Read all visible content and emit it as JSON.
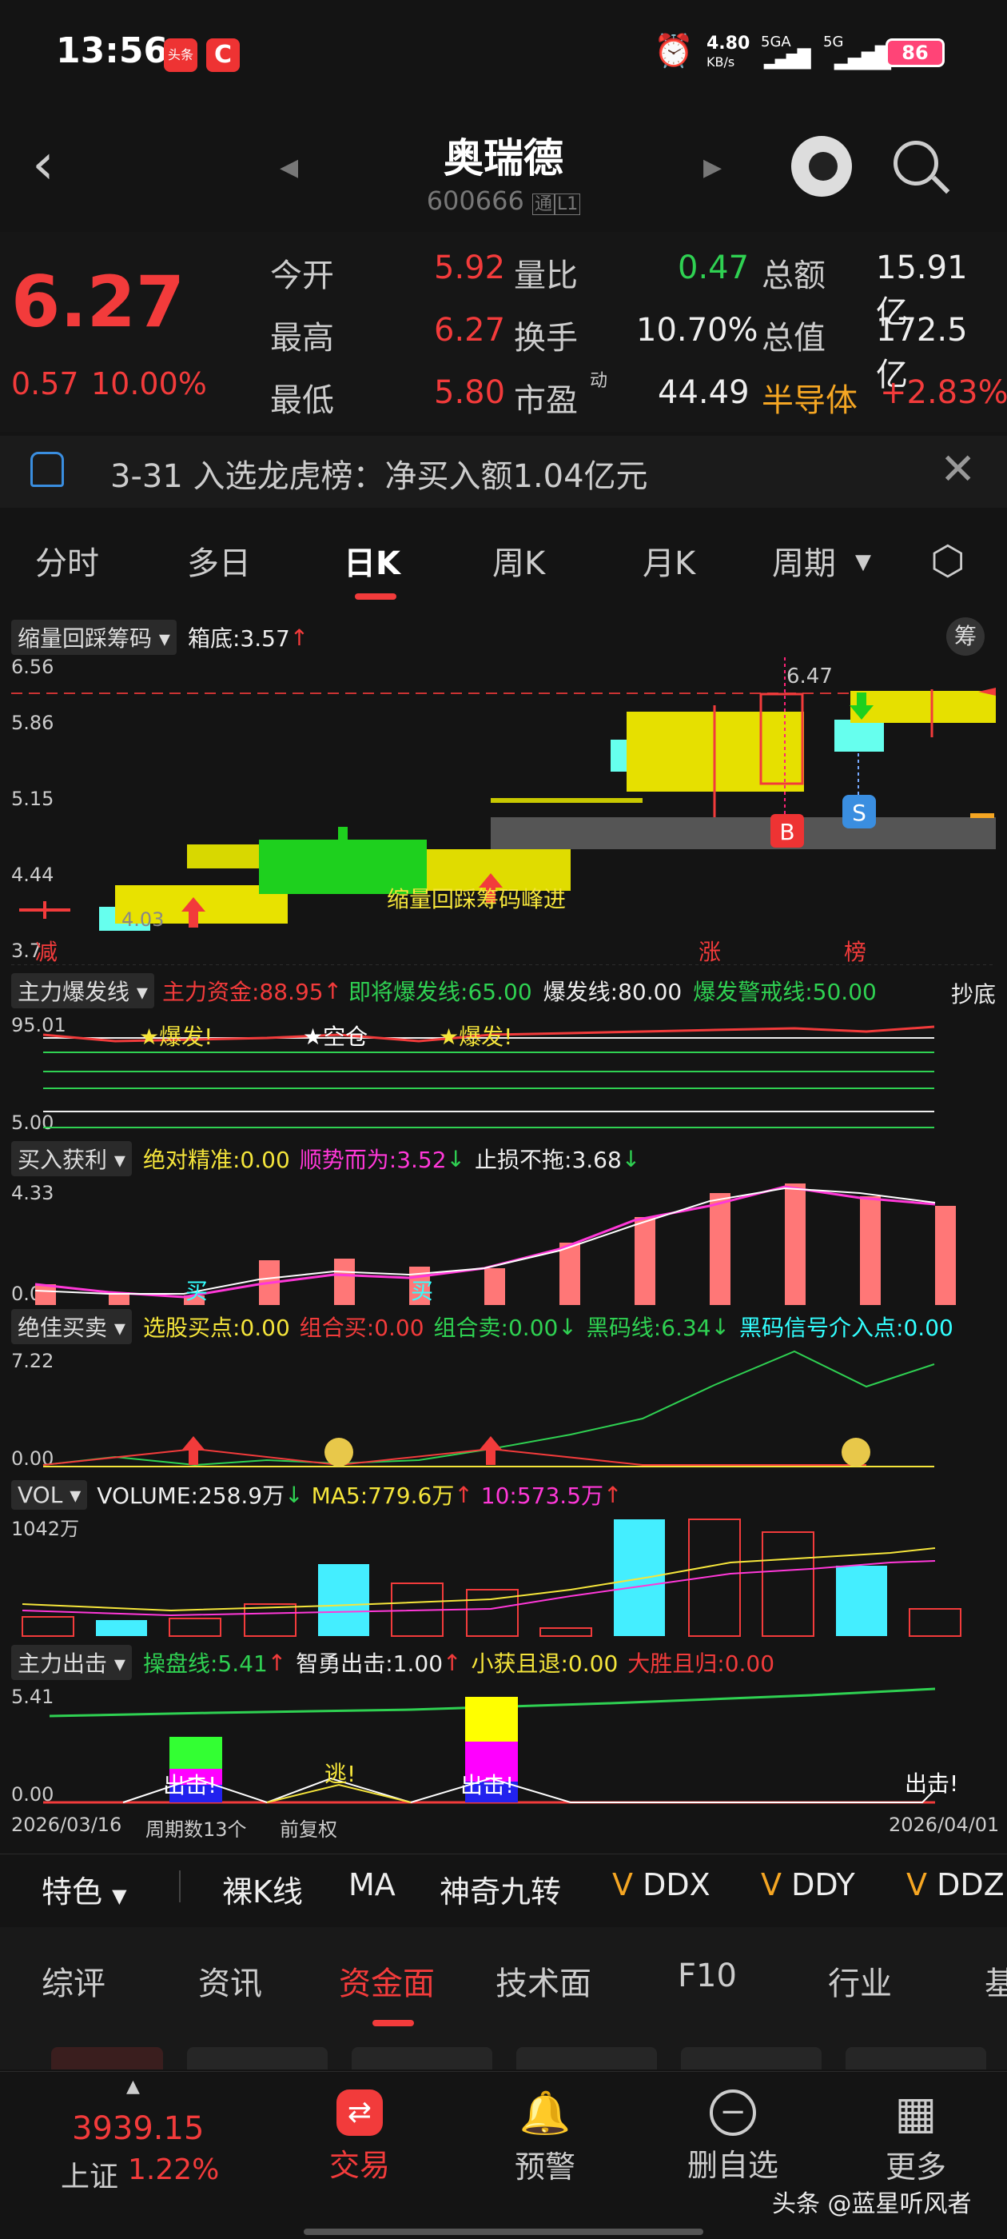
{
  "status": {
    "time": "13:56",
    "net_speed": "4.80",
    "net_unit": "KB/s",
    "sig1": "5GA",
    "sig2": "5G",
    "battery": "86",
    "app_icon1": "头条",
    "app_icon2": "C"
  },
  "header": {
    "title": "奥瑞德",
    "code": "600666",
    "tag1": "通",
    "tag2": "L1"
  },
  "quote": {
    "price": "6.27",
    "change": "0.57",
    "pct": "10.00%",
    "rows": [
      {
        "l1": "今开",
        "v1": "5.92",
        "l2": "量比",
        "v2": "0.47",
        "l3": "总额",
        "v3": "15.91亿"
      },
      {
        "l1": "最高",
        "v1": "6.27",
        "l2": "换手",
        "v2": "10.70%",
        "l3": "总值",
        "v3": "172.5亿"
      },
      {
        "l1": "最低",
        "v1": "5.80",
        "l2": "市盈",
        "l2sup": "动",
        "v2": "44.49",
        "l3": "半导体",
        "v3": "+2.83%"
      }
    ]
  },
  "notice": {
    "text": "3-31 入选龙虎榜：净买入额1.04亿元"
  },
  "period_tabs": [
    "分时",
    "多日",
    "日K",
    "周K",
    "月K",
    "周期"
  ],
  "main_ind": {
    "name": "缩量回踩筹码",
    "box": "箱底:3.57",
    "chip_btn": "筹",
    "y_labels": [
      "6.56",
      "5.86",
      "5.15",
      "4.44",
      "3.7"
    ],
    "high_label": "6.47",
    "low_label": "4.03",
    "annot": "缩量回踩筹码峰进",
    "b": "B",
    "s": "S",
    "markers": [
      "减",
      "涨",
      "榜"
    ]
  },
  "ind1": {
    "name": "主力爆发线",
    "items": [
      {
        "t": "主力资金:88.95",
        "c": "#f23b3b"
      },
      {
        "t": "即将爆发线:65.00",
        "c": "#2fd152"
      },
      {
        "t": "爆发线:80.00",
        "c": "#eee"
      },
      {
        "t": "爆发警戒线:50.00",
        "c": "#2fd152"
      }
    ],
    "tail": "抄底",
    "y_top": "95.01",
    "y_bot": "5.00",
    "labels": [
      "★爆发!",
      "★空仓",
      "★爆发!"
    ]
  },
  "ind2": {
    "name": "买入获利",
    "items": [
      {
        "t": "绝对精准:0.00",
        "c": "#f5e53b"
      },
      {
        "t": "顺势而为:3.52",
        "c": "#ff38d8"
      },
      {
        "t": "止损不拖:3.68",
        "c": "#eee"
      }
    ],
    "y_top": "4.33",
    "y_bot": "0.00",
    "buy": "买"
  },
  "ind3": {
    "name": "绝佳买卖",
    "items": [
      {
        "t": "选股买点:0.00",
        "c": "#f5e53b"
      },
      {
        "t": "组合买:0.00",
        "c": "#f23b3b"
      },
      {
        "t": "组合卖:0.00",
        "c": "#2fd152"
      },
      {
        "t": "黑码线:6.34",
        "c": "#2fd152"
      },
      {
        "t": "黑码信号介入点:0.00",
        "c": "#3ff"
      }
    ],
    "y_top": "7.22",
    "y_bot": "0.00"
  },
  "ind4": {
    "name": "VOL",
    "items": [
      {
        "t": "VOLUME:258.9万",
        "c": "#eee"
      },
      {
        "t": "MA5:779.6万",
        "c": "#f5e53b"
      },
      {
        "t": "10:573.5万",
        "c": "#ff38d8"
      }
    ],
    "y_top": "1042万"
  },
  "ind5": {
    "name": "主力出击",
    "items": [
      {
        "t": "操盘线:5.41",
        "c": "#2fd152"
      },
      {
        "t": "智勇出击:1.00",
        "c": "#eee"
      },
      {
        "t": "小获且退:0.00",
        "c": "#f5e53b"
      },
      {
        "t": "大胜且归:0.00",
        "c": "#f23b3b"
      }
    ],
    "y_top": "5.41",
    "y_bot": "0.00",
    "labels": [
      "出击!",
      "逃!",
      "出击!",
      "出击!"
    ]
  },
  "footer_info": {
    "start": "2026/03/16",
    "count": "周期数13个",
    "adj": "前复权",
    "end": "2026/04/01"
  },
  "feature_bar": {
    "label": "特色",
    "items": [
      "裸K线",
      "MA",
      "神奇九转",
      "DDX",
      "DDY",
      "DDZ"
    ]
  },
  "section_tabs": [
    "综评",
    "资讯",
    "资金面",
    "技术面",
    "F10",
    "行业",
    "基"
  ],
  "bottom": {
    "index_val": "3939.15",
    "index_name": "上证",
    "index_pct": "1.22%",
    "nav": [
      "交易",
      "预警",
      "删自选",
      "更多"
    ],
    "watermark": "头条 @蓝星听风者"
  },
  "colors": {
    "up": "#f23b3b",
    "down": "#2fd152",
    "accent": "#f23b3b",
    "bg": "#141414"
  }
}
